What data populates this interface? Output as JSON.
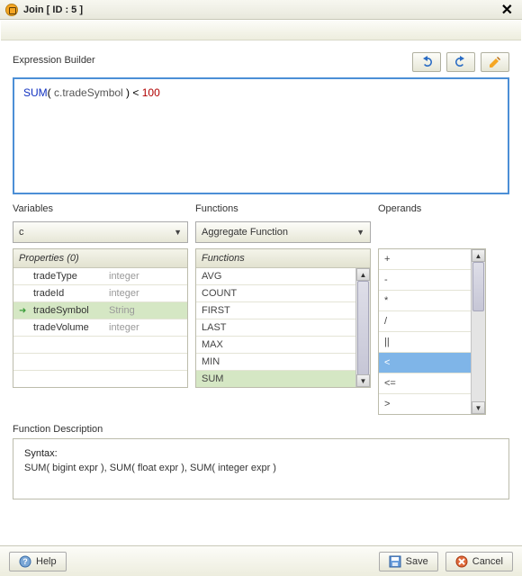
{
  "title": "Join [ ID : 5 ]",
  "sections": {
    "expression_label": "Expression Builder",
    "variables_label": "Variables",
    "functions_label": "Functions",
    "operands_label": "Operands",
    "function_desc_label": "Function Description",
    "properties_header": "Properties (0)",
    "functions_header": "Functions"
  },
  "toolbar": {
    "undo": "undo",
    "redo": "redo",
    "edit": "edit"
  },
  "expression": {
    "func": "SUM",
    "open": "( ",
    "field": "c.tradeSymbol",
    "close": " ) ",
    "op": "< ",
    "num": "100"
  },
  "variables": {
    "dropdown": "c",
    "items": [
      {
        "name": "tradeType",
        "type": "integer",
        "selected": false
      },
      {
        "name": "tradeId",
        "type": "integer",
        "selected": false
      },
      {
        "name": "tradeSymbol",
        "type": "String",
        "selected": true
      },
      {
        "name": "tradeVolume",
        "type": "integer",
        "selected": false
      }
    ]
  },
  "functions": {
    "dropdown": "Aggregate Function",
    "items": [
      "AVG",
      "COUNT",
      "FIRST",
      "LAST",
      "MAX",
      "MIN",
      "SUM"
    ],
    "selected": "SUM"
  },
  "operands": {
    "items": [
      "+",
      "-",
      "*",
      "/",
      "||",
      "<",
      "<=",
      ">"
    ],
    "selected": "<"
  },
  "description": {
    "syntax_label": "Syntax:",
    "syntax": "SUM( bigint expr ), SUM( float expr ), SUM( integer expr )"
  },
  "footer": {
    "help": "Help",
    "save": "Save",
    "cancel": "Cancel"
  },
  "chart_data": null
}
